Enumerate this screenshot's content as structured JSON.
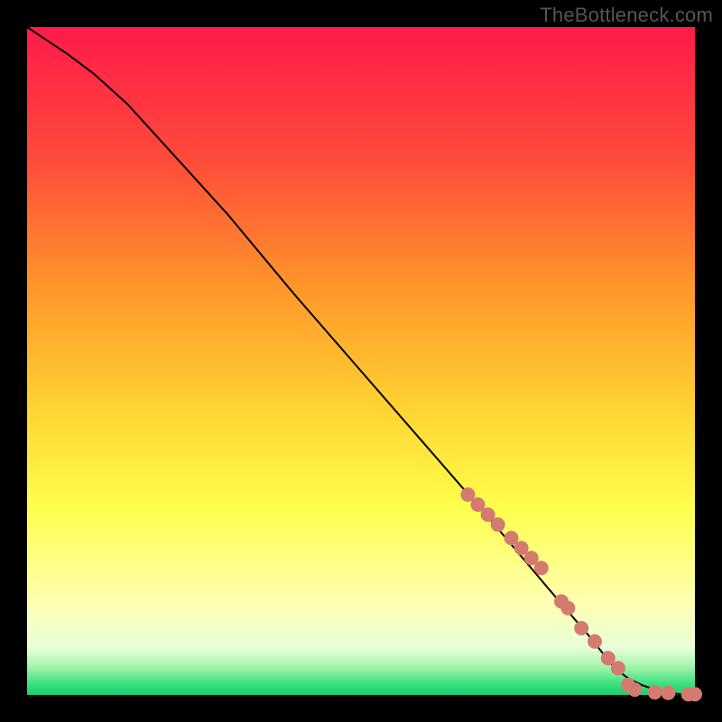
{
  "watermark": "TheBottleneck.com",
  "gradient_stops": [
    {
      "pct": 0,
      "color": "#ff1a4b"
    },
    {
      "pct": 20,
      "color": "#ff4b3a"
    },
    {
      "pct": 40,
      "color": "#ff9a2a"
    },
    {
      "pct": 58,
      "color": "#ffd633"
    },
    {
      "pct": 72,
      "color": "#ffff4d"
    },
    {
      "pct": 86,
      "color": "#ffffb0"
    },
    {
      "pct": 93,
      "color": "#e8ffd8"
    },
    {
      "pct": 96,
      "color": "#9cf2a8"
    },
    {
      "pct": 98.5,
      "color": "#35e07a"
    },
    {
      "pct": 100,
      "color": "#17cf72"
    }
  ],
  "chart_data": {
    "type": "line",
    "title": "",
    "xlabel": "",
    "ylabel": "",
    "xlim": [
      0,
      100
    ],
    "ylim": [
      0,
      100
    ],
    "grid": false,
    "series": [
      {
        "name": "curve",
        "color": "#000000",
        "stroke_width": 2,
        "x": [
          0,
          3,
          6,
          10,
          15,
          20,
          30,
          40,
          50,
          60,
          70,
          78,
          84,
          88,
          90,
          92,
          94,
          96,
          98,
          100
        ],
        "y": [
          100,
          98,
          96,
          93,
          88.5,
          83,
          72,
          60,
          48.5,
          37,
          25.5,
          16,
          9,
          4,
          2.5,
          1.5,
          0.8,
          0.3,
          0.1,
          0.05
        ]
      }
    ],
    "markers": [
      {
        "x": 66,
        "y": 30,
        "r": 8,
        "color": "#d57a70"
      },
      {
        "x": 67.5,
        "y": 28.5,
        "r": 8,
        "color": "#d57a70"
      },
      {
        "x": 69,
        "y": 27,
        "r": 8,
        "color": "#d57a70"
      },
      {
        "x": 70.5,
        "y": 25.5,
        "r": 8,
        "color": "#d57a70"
      },
      {
        "x": 72.5,
        "y": 23.5,
        "r": 8,
        "color": "#d57a70"
      },
      {
        "x": 74,
        "y": 22,
        "r": 8,
        "color": "#d57a70"
      },
      {
        "x": 75.5,
        "y": 20.5,
        "r": 8,
        "color": "#d57a70"
      },
      {
        "x": 77,
        "y": 19,
        "r": 8,
        "color": "#d57a70"
      },
      {
        "x": 80,
        "y": 14,
        "r": 8,
        "color": "#d57a70"
      },
      {
        "x": 81,
        "y": 13,
        "r": 8,
        "color": "#d57a70"
      },
      {
        "x": 83,
        "y": 10,
        "r": 8,
        "color": "#d57a70"
      },
      {
        "x": 85,
        "y": 8,
        "r": 8,
        "color": "#d57a70"
      },
      {
        "x": 87,
        "y": 5.5,
        "r": 8,
        "color": "#d57a70"
      },
      {
        "x": 88.5,
        "y": 4,
        "r": 8,
        "color": "#d57a70"
      },
      {
        "x": 90,
        "y": 1.5,
        "r": 8,
        "color": "#d57a70"
      },
      {
        "x": 91,
        "y": 0.8,
        "r": 8,
        "color": "#d57a70"
      },
      {
        "x": 94,
        "y": 0.4,
        "r": 8,
        "color": "#d57a70"
      },
      {
        "x": 96,
        "y": 0.3,
        "r": 8,
        "color": "#d57a70"
      },
      {
        "x": 99,
        "y": 0.1,
        "r": 8,
        "color": "#d57a70"
      },
      {
        "x": 100,
        "y": 0.1,
        "r": 8,
        "color": "#d57a70"
      }
    ]
  }
}
